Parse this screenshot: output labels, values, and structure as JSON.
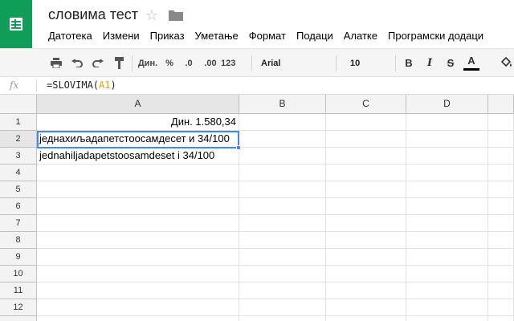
{
  "app": {
    "doc_title": "словима тест",
    "brand_color": "#0f9d58",
    "logo_icon": "sheets-logo-icon",
    "star_icon": "star-icon",
    "folder_icon": "folder-icon"
  },
  "menu": {
    "items": [
      "Датотека",
      "Измени",
      "Приказ",
      "Уметање",
      "Формат",
      "Подаци",
      "Алатке",
      "Програмски додаци"
    ]
  },
  "toolbar": {
    "print_icon": "print-icon",
    "undo_icon": "undo-icon",
    "redo_icon": "redo-icon",
    "paint_format_icon": "paint-format-icon",
    "currency_label": "Дин.",
    "percent_label": "%",
    "decrease_decimal_label": ".0",
    "increase_decimal_label": ".00",
    "more_formats_label": "123",
    "font_family": "Arial",
    "font_size": "10",
    "bold_label": "B",
    "italic_label": "I",
    "strikethrough_label": "S",
    "text_color_label": "A",
    "fill_color_icon": "fill-color-icon"
  },
  "formula_bar": {
    "fx_label": "fx",
    "formula_prefix": "=SLOVIMA(",
    "formula_ref": "A1",
    "formula_suffix": ")"
  },
  "grid": {
    "columns": [
      "A",
      "B",
      "C",
      "D"
    ],
    "rows": [
      "1",
      "2",
      "3",
      "4",
      "5",
      "6",
      "7",
      "8",
      "9",
      "10",
      "11",
      "12"
    ],
    "cells": {
      "A1": "Дин. 1.580,34",
      "A2": "једнахиљадапетстоосамдесет и 34/100",
      "A3": "jednahiljadapetstoosamdeset i 34/100"
    },
    "selected_cell": "A2",
    "selection_color": "#4285f4"
  }
}
